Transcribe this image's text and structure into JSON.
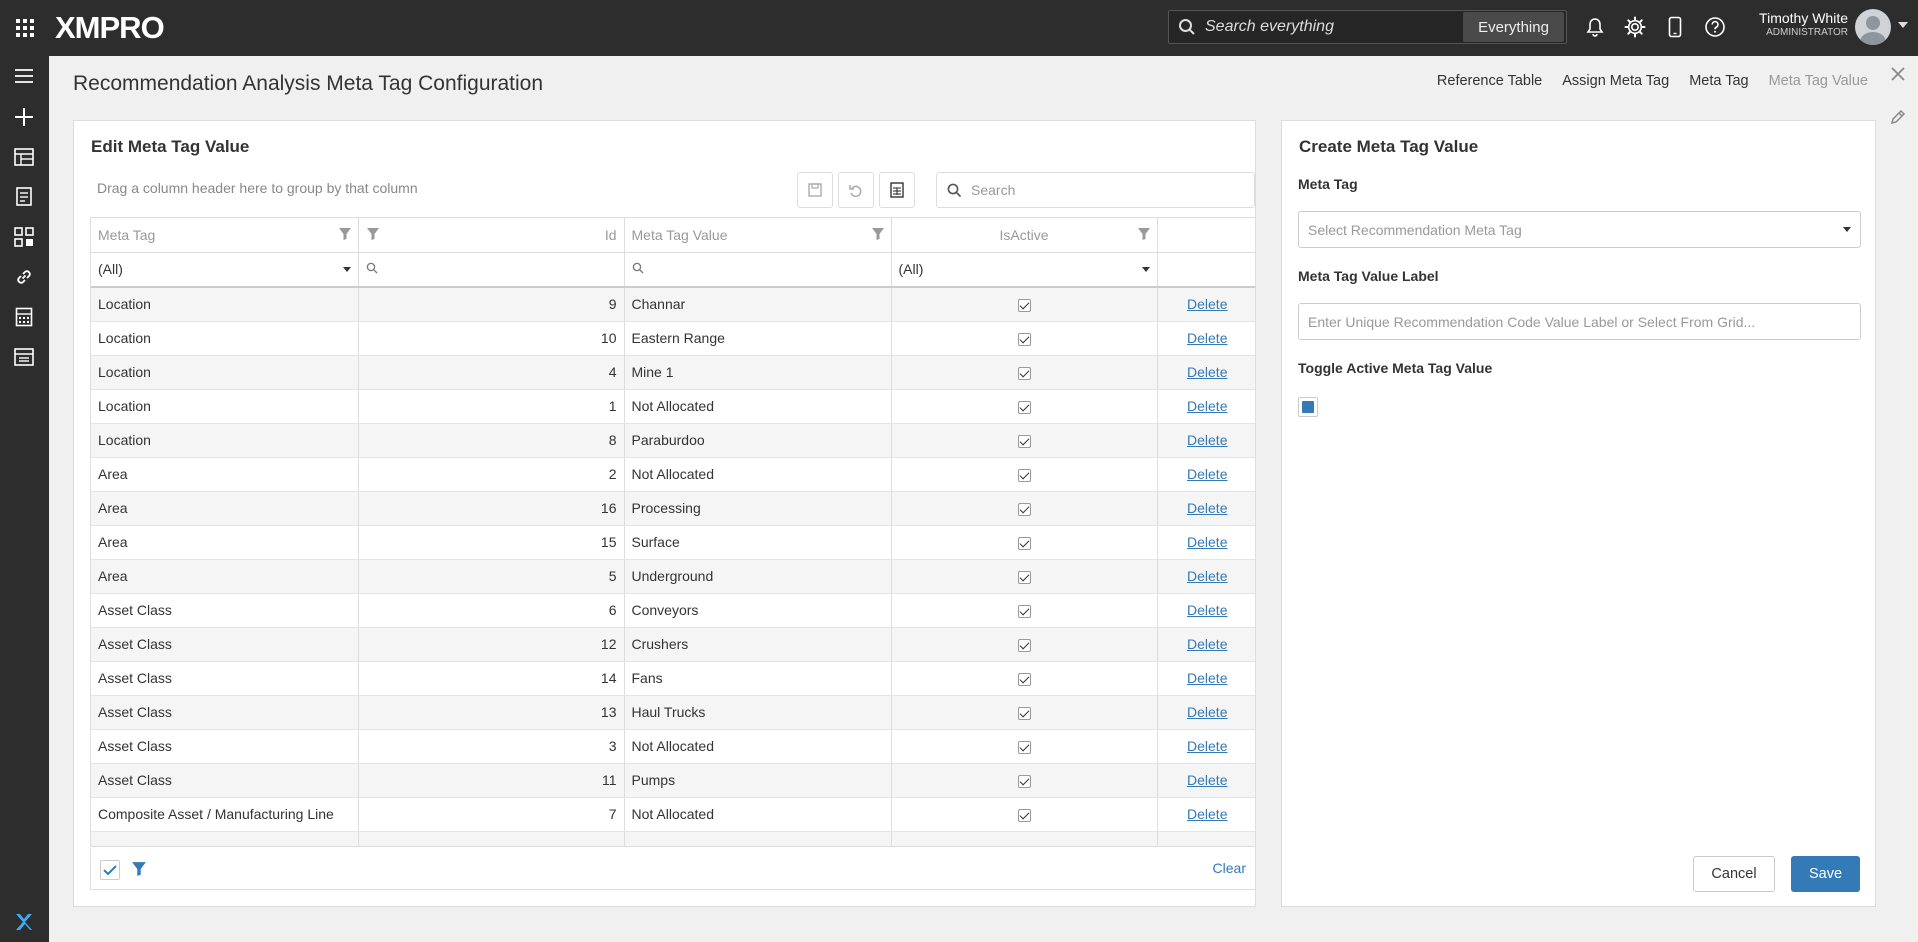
{
  "header": {
    "logo": "XMPRO",
    "search_placeholder": "Search everything",
    "search_scope": "Everything",
    "user_name": "Timothy White",
    "user_role": "ADMINISTRATOR"
  },
  "page": {
    "title": "Recommendation Analysis Meta Tag Configuration",
    "nav": {
      "reference_table": "Reference Table",
      "assign_meta_tag": "Assign Meta Tag",
      "meta_tag": "Meta Tag",
      "meta_tag_value": "Meta Tag Value"
    }
  },
  "edit_card": {
    "title": "Edit Meta Tag Value",
    "group_hint": "Drag a column header here to group by that column",
    "search_placeholder": "Search",
    "columns": {
      "meta_tag": "Meta Tag",
      "id": "Id",
      "meta_tag_value": "Meta Tag Value",
      "is_active": "IsActive"
    },
    "filters": {
      "meta_tag": "(All)",
      "is_active": "(All)"
    },
    "delete_label": "Delete",
    "clear_label": "Clear",
    "rows": [
      {
        "meta_tag": "Location",
        "id": "9",
        "value": "Channar"
      },
      {
        "meta_tag": "Location",
        "id": "10",
        "value": "Eastern Range"
      },
      {
        "meta_tag": "Location",
        "id": "4",
        "value": "Mine 1"
      },
      {
        "meta_tag": "Location",
        "id": "1",
        "value": "Not Allocated"
      },
      {
        "meta_tag": "Location",
        "id": "8",
        "value": "Paraburdoo"
      },
      {
        "meta_tag": "Area",
        "id": "2",
        "value": "Not Allocated"
      },
      {
        "meta_tag": "Area",
        "id": "16",
        "value": "Processing"
      },
      {
        "meta_tag": "Area",
        "id": "15",
        "value": "Surface"
      },
      {
        "meta_tag": "Area",
        "id": "5",
        "value": "Underground"
      },
      {
        "meta_tag": "Asset Class",
        "id": "6",
        "value": "Conveyors"
      },
      {
        "meta_tag": "Asset Class",
        "id": "12",
        "value": "Crushers"
      },
      {
        "meta_tag": "Asset Class",
        "id": "14",
        "value": "Fans"
      },
      {
        "meta_tag": "Asset Class",
        "id": "13",
        "value": "Haul Trucks"
      },
      {
        "meta_tag": "Asset Class",
        "id": "3",
        "value": "Not Allocated"
      },
      {
        "meta_tag": "Asset Class",
        "id": "11",
        "value": "Pumps"
      },
      {
        "meta_tag": "Composite Asset / Manufacturing Line",
        "id": "7",
        "value": "Not Allocated"
      }
    ]
  },
  "create_card": {
    "title": "Create Meta Tag Value",
    "meta_tag_label": "Meta Tag",
    "meta_tag_placeholder": "Select Recommendation Meta Tag",
    "value_label": "Meta Tag Value Label",
    "value_placeholder": "Enter Unique Recommendation Code Value Label or Select From Grid...",
    "toggle_label": "Toggle Active Meta Tag Value",
    "cancel": "Cancel",
    "save": "Save"
  },
  "colors": {
    "topbar": "#2d2d2d",
    "accent": "#337ab7"
  }
}
